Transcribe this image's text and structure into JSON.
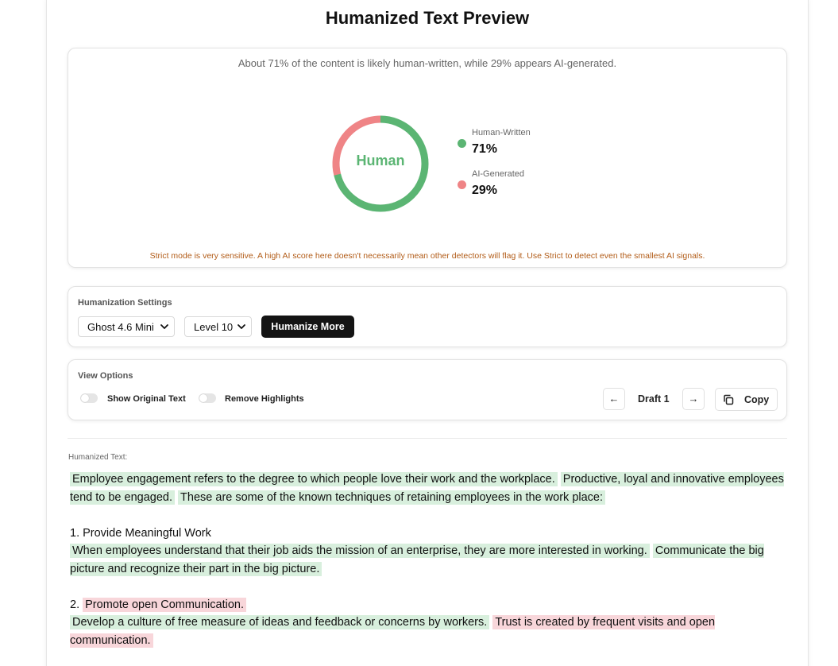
{
  "page_title": "Humanized Text Preview",
  "detection": {
    "summary": "About 71% of the content is likely human-written, while 29% appears AI-generated.",
    "center_label": "Human",
    "human": {
      "label": "Human-Written",
      "value": "71%",
      "percent": 71,
      "color": "#5bb573"
    },
    "ai": {
      "label": "AI-Generated",
      "value": "29%",
      "percent": 29,
      "color": "#ef8486"
    },
    "warning": "Strict mode is very sensitive. A high AI score here doesn't necessarily mean other detectors will flag it. Use Strict to detect even the smallest AI signals."
  },
  "settings": {
    "label": "Humanization Settings",
    "model_value": "Ghost 4.6 Mini",
    "level_value": "Level 10",
    "humanize_button": "Humanize More"
  },
  "view_options": {
    "label": "View Options",
    "show_original": {
      "label": "Show Original Text",
      "checked": false
    },
    "remove_highlights": {
      "label": "Remove Highlights",
      "checked": false
    },
    "prev_glyph": "←",
    "next_glyph": "→",
    "draft_label": "Draft 1",
    "copy_label": "Copy"
  },
  "output": {
    "label": "Humanized Text:",
    "paragraphs": [
      [
        {
          "text": "Employee engagement refers to the degree to which people love their work and the workplace.",
          "type": "human"
        },
        {
          "text": "Productive, loyal and innovative employees tend to be engaged.",
          "type": "human"
        },
        {
          "text": "These are some of the known techniques of retaining employees in the work place:",
          "type": "human"
        }
      ],
      [
        {
          "text": "1. Provide Meaningful Work",
          "type": "plain",
          "line_break_after": true
        },
        {
          "text": "When employees understand that their job aids the mission of an enterprise, they are more interested in working.",
          "type": "human"
        },
        {
          "text": "Communicate the big picture and recognize their part in the big picture.",
          "type": "human"
        }
      ],
      [
        {
          "text": "2.",
          "type": "plain"
        },
        {
          "text": "Promote open Communication.",
          "type": "ai",
          "line_break_after": true
        },
        {
          "text": "Develop a culture of free measure of ideas and feedback or concerns by workers.",
          "type": "human"
        },
        {
          "text": "Trust is created by frequent visits and open communication.",
          "type": "ai"
        }
      ]
    ]
  }
}
